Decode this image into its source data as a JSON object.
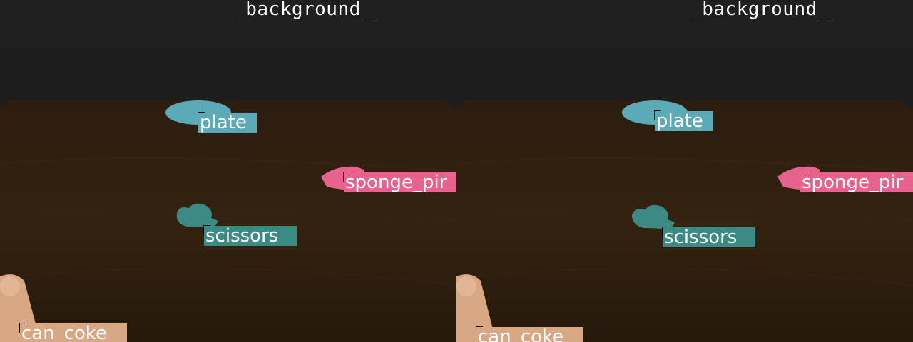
{
  "panels": [
    {
      "background_label": "_background_",
      "labels": {
        "plate": "plate",
        "sponge": "sponge_pir",
        "scissors": "scissors",
        "can": "can_coke"
      }
    },
    {
      "background_label": "_background_",
      "labels": {
        "plate": "plate",
        "sponge": "sponge_pir",
        "scissors": "scissors",
        "can": "can_coke"
      }
    }
  ],
  "colors": {
    "plate": "#5aaab8",
    "sponge": "#e8628e",
    "scissors": "#3b8a84",
    "can": "#d8a784",
    "table": "#2e1f12"
  }
}
